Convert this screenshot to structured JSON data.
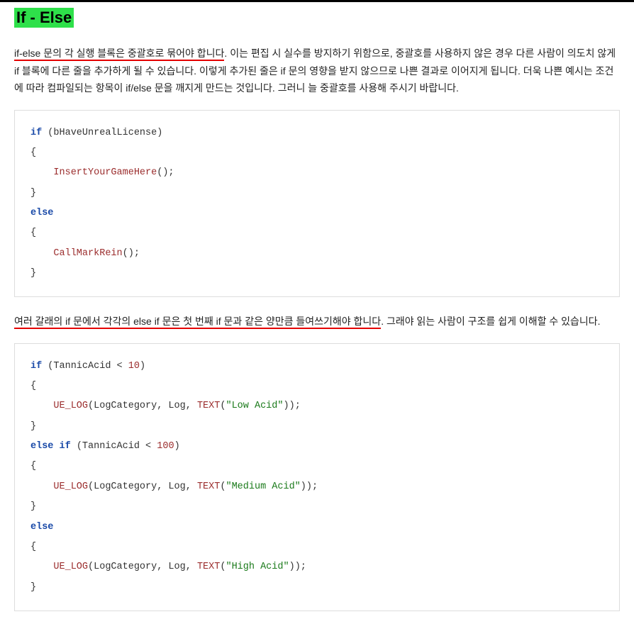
{
  "heading": "If - Else",
  "para1": {
    "highlight": "if-else 문의 각 실행 블록은 중괄호로 묶어야 합니다",
    "rest": ". 이는 편집 시 실수를 방지하기 위함으로, 중괄호를 사용하지 않은 경우 다른 사람이 의도치 않게 if 블록에 다른 줄을 추가하게 될 수 있습니다. 이렇게 추가된 줄은 if 문의 영향을 받지 않으므로 나쁜 결과로 이어지게 됩니다. 더욱 나쁜 예시는 조건에 따라 컴파일되는 항목이 if/else 문을 깨지게 만드는 것입니다. 그러니 늘 중괄호를 사용해 주시기 바랍니다."
  },
  "code1": {
    "kw_if": "if",
    "cond1_open": " (",
    "cond1_var": "bHaveUnrealLicense",
    "cond1_close": ")",
    "lbrace1": "{",
    "call1": "    InsertYourGameHere",
    "call1_paren": "();",
    "rbrace1": "}",
    "kw_else": "else",
    "lbrace2": "{",
    "call2": "    CallMarkRein",
    "call2_paren": "();",
    "rbrace2": "}"
  },
  "para2": {
    "highlight": "여러 갈래의 if 문에서 각각의 else if 문은 첫 번째 if 문과 같은 양만큼 들여쓰기해야 합니다",
    "rest": ". 그래야 읽는 사람이 구조를 쉽게 이해할 수 있습니다."
  },
  "code2": {
    "kw_if": "if",
    "c1_open": " (",
    "c1_var": "TannicAcid",
    "c1_op": " < ",
    "c1_num": "10",
    "c1_close": ")",
    "lb1": "{",
    "indent": "    ",
    "uelog": "UE_LOG",
    "args_open": "(LogCategory, Log, ",
    "textfn": "TEXT",
    "tp_open": "(",
    "str1": "\"Low Acid\"",
    "tp_close": ")",
    "args_close": ");",
    "rb1": "}",
    "kw_elseif": "else if",
    "c2_open": " (",
    "c2_var": "TannicAcid",
    "c2_op": " < ",
    "c2_num": "100",
    "c2_close": ")",
    "lb2": "{",
    "str2": "\"Medium Acid\"",
    "rb2": "}",
    "kw_else": "else",
    "lb3": "{",
    "str3": "\"High Acid\"",
    "rb3": "}"
  }
}
